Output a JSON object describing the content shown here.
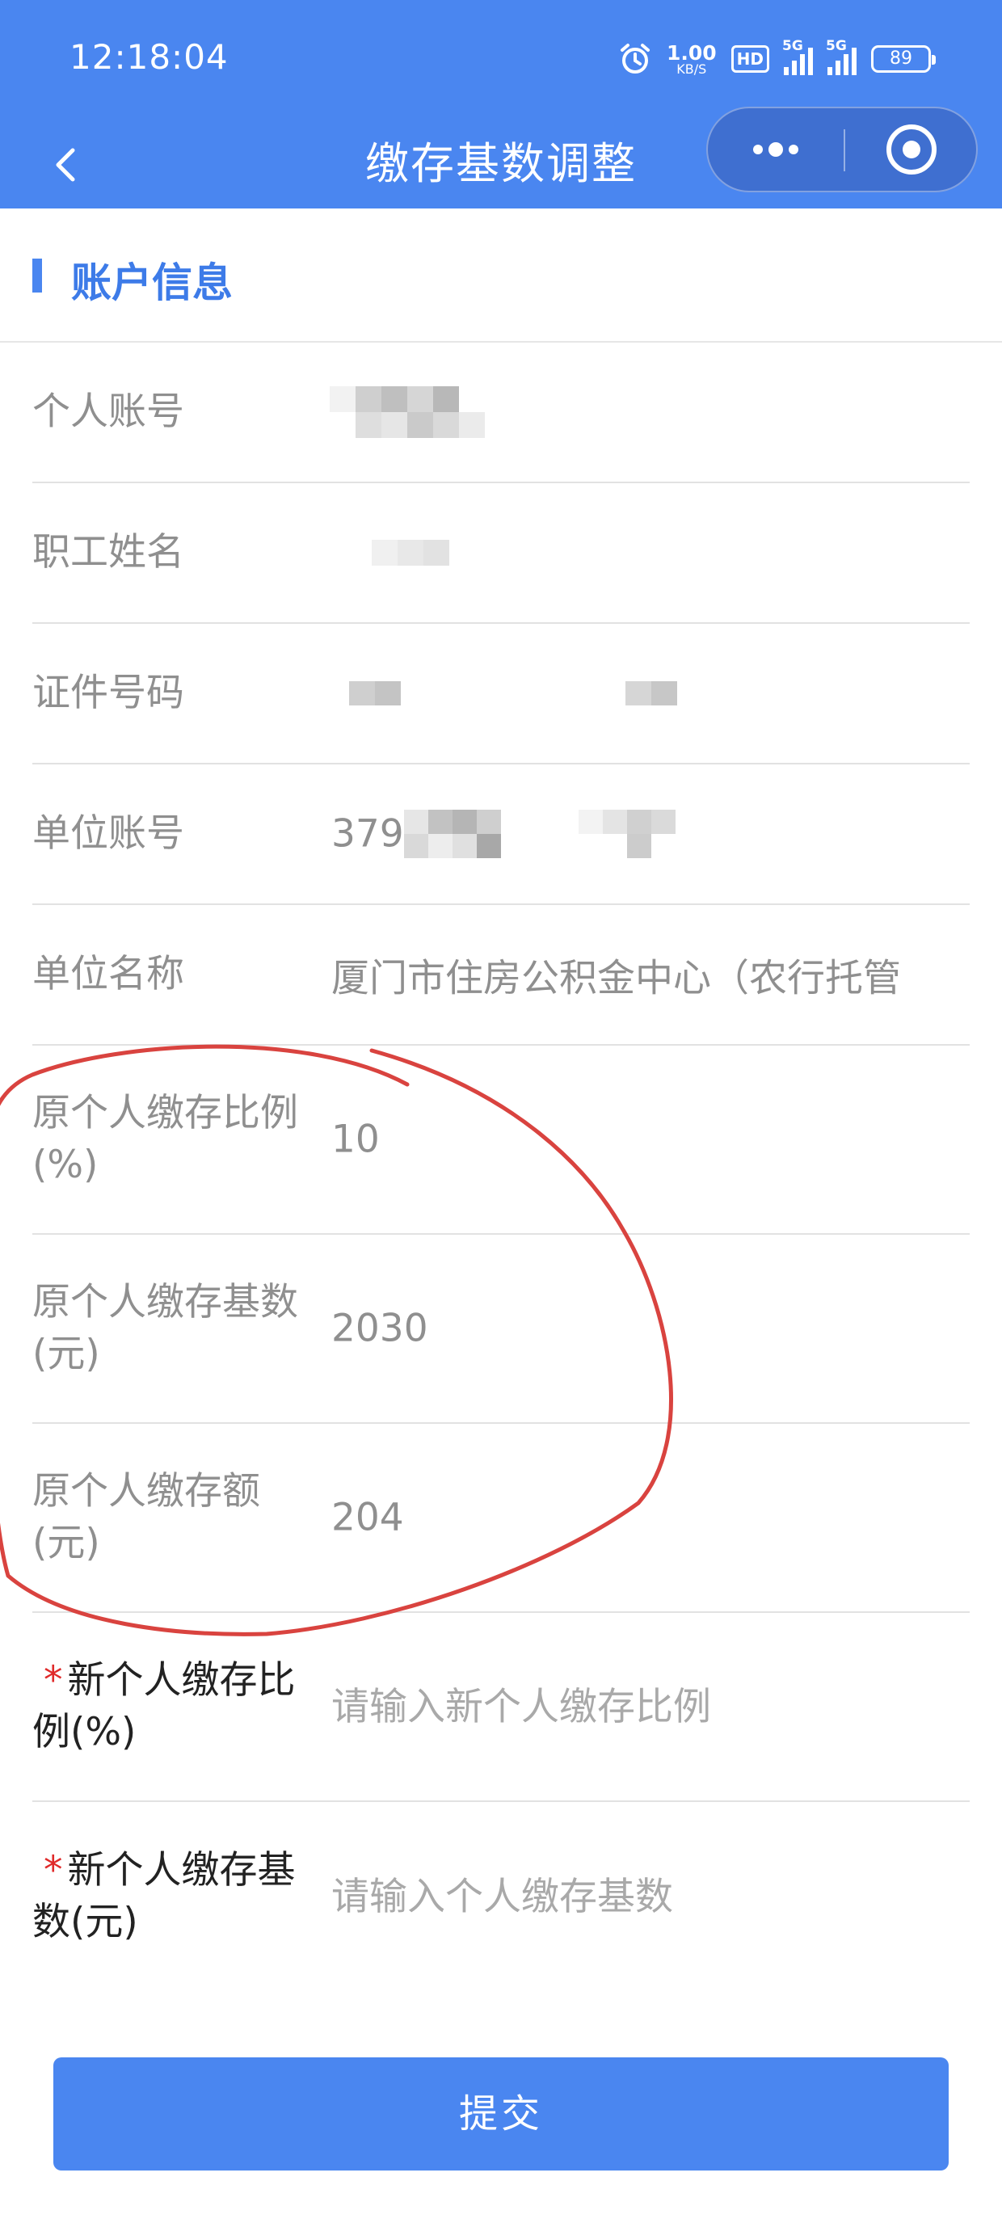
{
  "status_bar": {
    "time": "12:18:04",
    "net_speed_value": "1.00",
    "net_speed_unit": "KB/S",
    "hd_label": "HD",
    "signal_1_label": "5G",
    "signal_2_label": "5G",
    "battery": "89"
  },
  "nav": {
    "title": "缴存基数调整"
  },
  "section": {
    "title": "账户信息"
  },
  "fields": {
    "personal_account": {
      "label": "个人账号",
      "value": ""
    },
    "employee_name": {
      "label": "职工姓名",
      "value": ""
    },
    "id_number": {
      "label": "证件号码",
      "value": ""
    },
    "company_account": {
      "label": "单位账号",
      "value": "379"
    },
    "company_name": {
      "label": "单位名称",
      "value": "厦门市住房公积金中心（农行托管"
    },
    "orig_ratio": {
      "label": "原个人缴存比例(%)",
      "value": "10"
    },
    "orig_base": {
      "label": "原个人缴存基数(元)",
      "value": "2030"
    },
    "orig_amount": {
      "label": "原个人缴存额(元)",
      "value": "204"
    },
    "new_ratio": {
      "label": "新个人缴存比例(%)",
      "required_mark": "*",
      "value": "",
      "placeholder": "请输入新个人缴存比例"
    },
    "new_base": {
      "label": "新个人缴存基数(元)",
      "required_mark": "*",
      "value": "",
      "placeholder": "请输入个人缴存基数"
    }
  },
  "submit_label": "提交",
  "colors": {
    "primary": "#4a86f0",
    "section_title": "#3d7be8",
    "required": "#e02a2a",
    "annotation": "#d9433f"
  },
  "icons": {
    "back": "chevron-left-icon",
    "more": "more-dots-icon",
    "close": "target-circle-icon",
    "alarm": "alarm-clock-icon"
  }
}
